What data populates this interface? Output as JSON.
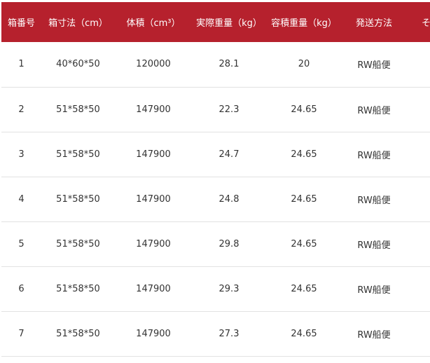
{
  "table": {
    "headers": [
      "箱番号",
      "箱寸法（cm）",
      "体積（cm³）",
      "実際重量（kg）",
      "容積重量（kg）",
      "発送方法",
      "そ"
    ],
    "rows": [
      [
        "1",
        "40*60*50",
        "120000",
        "28.1",
        "20",
        "RW船便",
        ""
      ],
      [
        "2",
        "51*58*50",
        "147900",
        "22.3",
        "24.65",
        "RW船便",
        ""
      ],
      [
        "3",
        "51*58*50",
        "147900",
        "24.7",
        "24.65",
        "RW船便",
        ""
      ],
      [
        "4",
        "51*58*50",
        "147900",
        "24.8",
        "24.65",
        "RW船便",
        ""
      ],
      [
        "5",
        "51*58*50",
        "147900",
        "29.8",
        "24.65",
        "RW船便",
        ""
      ],
      [
        "6",
        "51*58*50",
        "147900",
        "29.3",
        "24.65",
        "RW船便",
        ""
      ],
      [
        "7",
        "51*58*50",
        "147900",
        "27.3",
        "24.65",
        "RW船便",
        ""
      ]
    ]
  },
  "colors": {
    "header_bg": "#b6212d",
    "header_text": "#ffffff",
    "row_border": "#e2e2e2"
  }
}
